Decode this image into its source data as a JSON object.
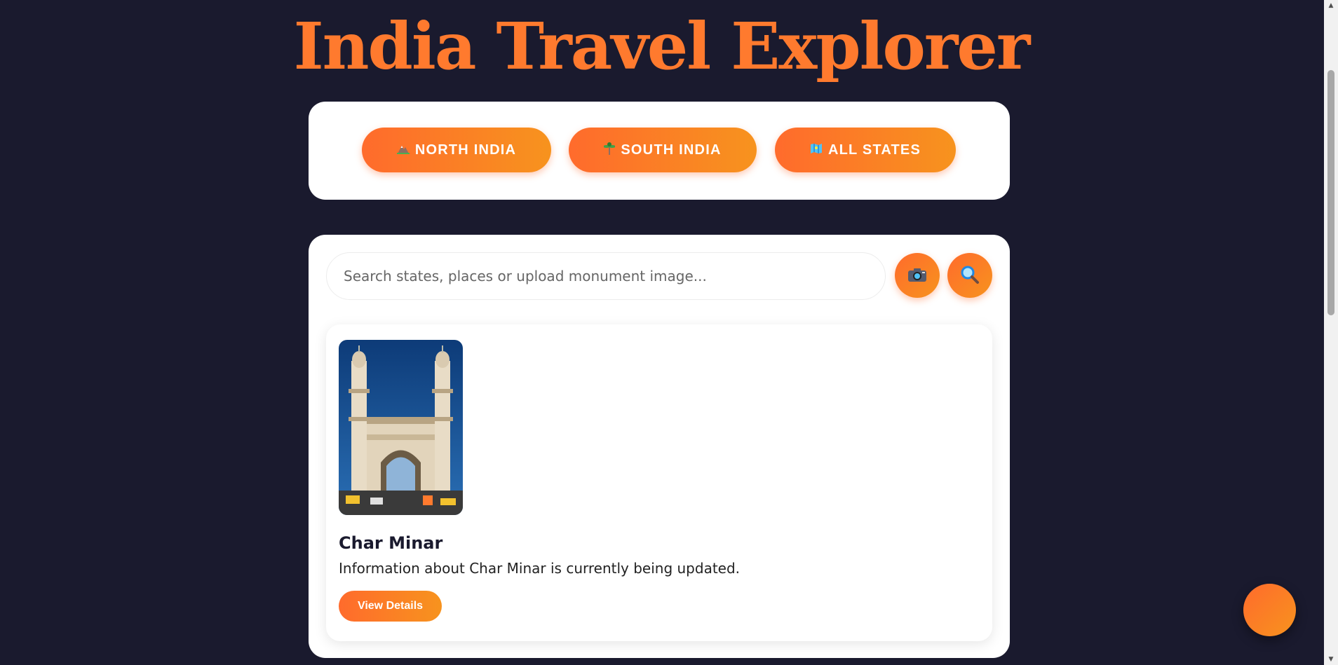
{
  "header": {
    "title": "India Travel Explorer"
  },
  "regions": [
    {
      "label": "NORTH INDIA",
      "icon": "mountain-icon"
    },
    {
      "label": "SOUTH INDIA",
      "icon": "palm-tree-icon"
    },
    {
      "label": "ALL STATES",
      "icon": "map-icon"
    }
  ],
  "search": {
    "placeholder": "Search states, places or upload monument image...",
    "camera_icon": "camera-icon",
    "search_icon": "magnifier-icon"
  },
  "result": {
    "name": "Char Minar",
    "description": "Information about Char Minar is currently being updated.",
    "button_label": "View Details"
  },
  "colors": {
    "background": "#1a1a2e",
    "accent": "#ff7a2e",
    "accent_gradient_end": "#f7931e",
    "card": "#ffffff"
  }
}
